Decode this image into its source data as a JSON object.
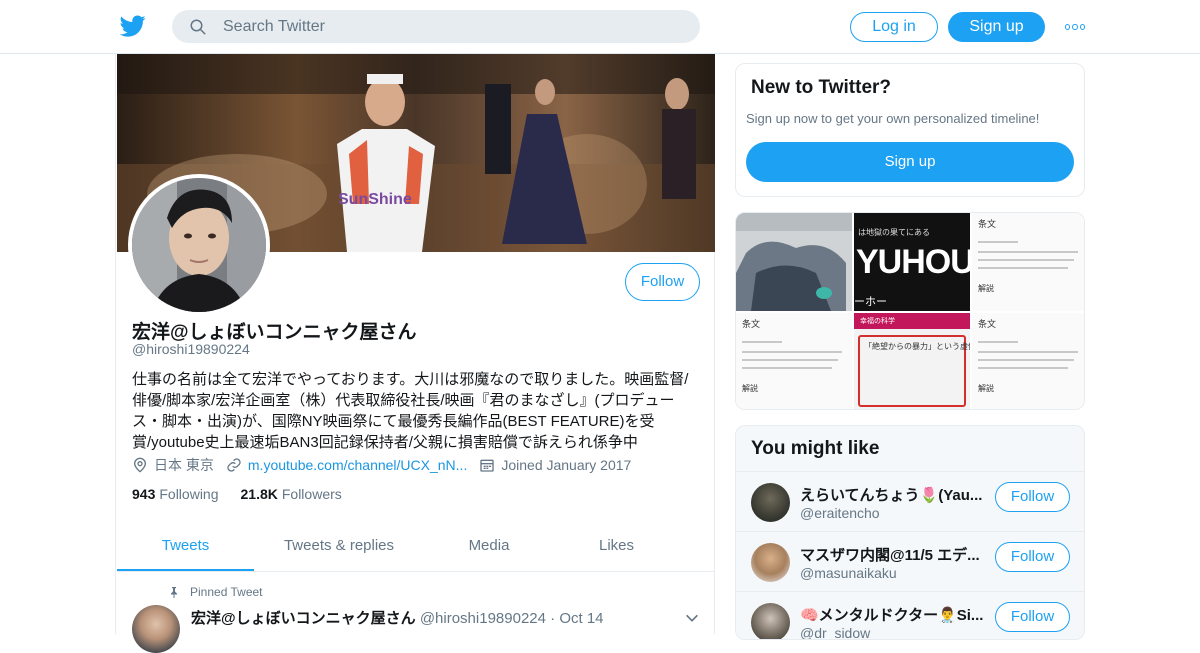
{
  "topbar": {
    "search_placeholder": "Search Twitter",
    "login_label": "Log in",
    "signup_label": "Sign up"
  },
  "profile": {
    "name": "宏洋@しょぼいコンニャク屋さん",
    "handle": "@hiroshi19890224",
    "follow_label": "Follow",
    "bio": "仕事の名前は全て宏洋でやっております。大川は邪魔なので取りました。映画監督/俳優/脚本家/宏洋企画室（株）代表取締役社長/映画『君のまなざし』(プロデュース・脚本・出演)が、国際NY映画祭にて最優秀長編作品(BEST FEATURE)を受賞/youtube史上最速垢BAN3回記録保持者/父親に損害賠償で訴えられ係争中",
    "location": "日本 東京",
    "url": "m.youtube.com/channel/UCX_nN...",
    "joined": "Joined January 2017",
    "following_count": "943",
    "following_label": "Following",
    "followers_count": "21.8K",
    "followers_label": "Followers"
  },
  "tabs": [
    {
      "label": "Tweets",
      "active": true
    },
    {
      "label": "Tweets & replies"
    },
    {
      "label": "Media"
    },
    {
      "label": "Likes"
    }
  ],
  "pinned_tweet": {
    "pinned_label": "Pinned Tweet",
    "name": "宏洋@しょぼいコンニャク屋さん",
    "handle": "@hiroshi19890224",
    "separator": "·",
    "date": "Oct 14"
  },
  "new_to_twitter": {
    "title": "New to Twitter?",
    "subtitle": "Sign up now to get your own personalized timeline!",
    "signup_label": "Sign up"
  },
  "media_grid": {
    "yuhou_caption": "は地獄の果てにある",
    "yuhou_title": "YUHOU",
    "yuhou_sub": "ーホー",
    "doc_header": "条文",
    "doc_section": "解説",
    "article_bar": "幸福の科学",
    "article_title": "「絶望からの暴力」という虚偽"
  },
  "you_might_like": {
    "title": "You might like",
    "users": [
      {
        "name": "えらいてんちょう🌷(Yau...",
        "handle": "@eraitencho",
        "follow_label": "Follow"
      },
      {
        "name": "マスザワ内閣@11/5 エデ...",
        "handle": "@masunaikaku",
        "follow_label": "Follow"
      },
      {
        "name": "🧠メンタルドクター👨‍⚕️Si...",
        "handle": "@dr_sidow",
        "follow_label": "Follow"
      }
    ]
  },
  "colors": {
    "accent": "#1da1f2",
    "link": "#1b95e0",
    "muted": "#657786",
    "border": "#e6ecf0"
  },
  "icons": [
    "twitter-bird-icon",
    "search-icon",
    "more-dots-icon",
    "location-pin-icon",
    "link-icon",
    "calendar-icon",
    "pin-icon",
    "chevron-down-icon"
  ]
}
